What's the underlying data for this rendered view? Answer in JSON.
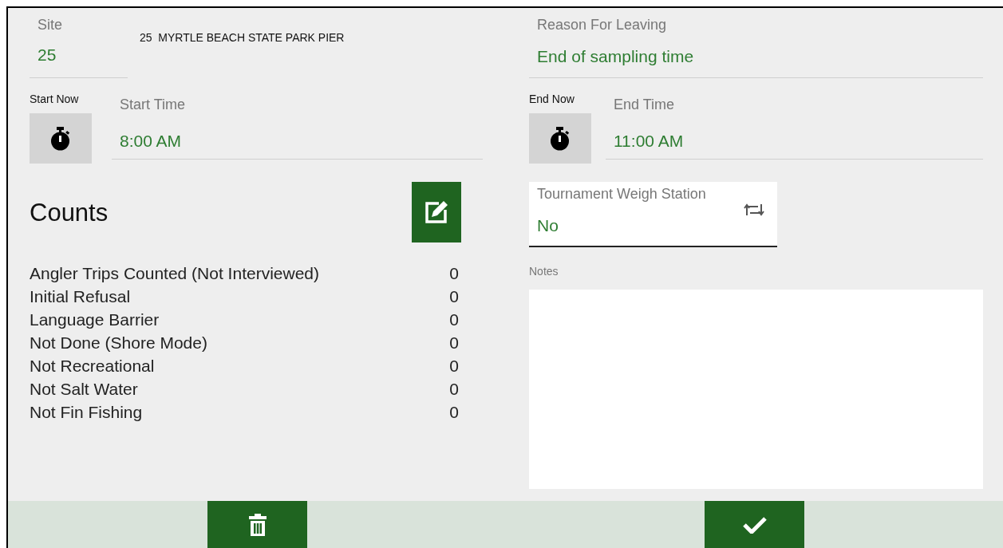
{
  "site": {
    "label": "Site",
    "value": "25",
    "name": "25  MYRTLE BEACH STATE PARK PIER"
  },
  "start": {
    "button_label": "Start Now",
    "label": "Start Time",
    "value": "8:00 AM"
  },
  "counts": {
    "title": "Counts",
    "rows": [
      {
        "label": "Angler Trips Counted (Not Interviewed)",
        "value": "0"
      },
      {
        "label": "Initial Refusal",
        "value": "0"
      },
      {
        "label": "Language Barrier",
        "value": "0"
      },
      {
        "label": "Not Done (Shore Mode)",
        "value": "0"
      },
      {
        "label": "Not Recreational",
        "value": "0"
      },
      {
        "label": "Not Salt Water",
        "value": "0"
      },
      {
        "label": "Not Fin Fishing",
        "value": "0"
      }
    ]
  },
  "reason": {
    "label": "Reason For Leaving",
    "value": "End of sampling time"
  },
  "end": {
    "button_label": "End Now",
    "label": "End Time",
    "value": "11:00 AM"
  },
  "tournament": {
    "label": "Tournament Weigh Station",
    "value": "No"
  },
  "notes": {
    "label": "Notes"
  }
}
